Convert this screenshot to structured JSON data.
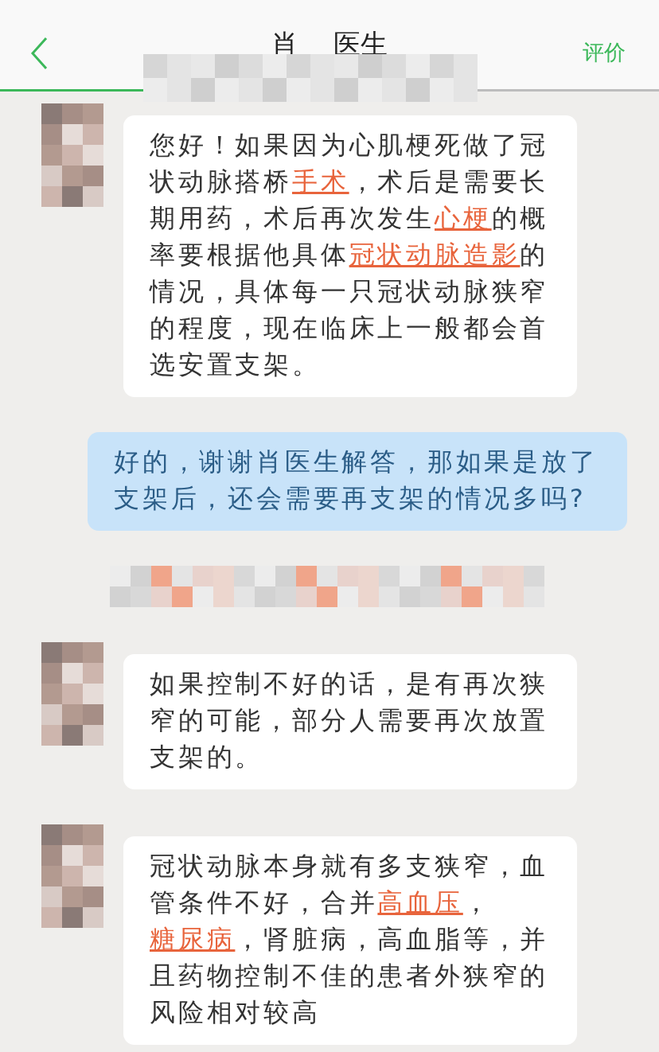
{
  "header": {
    "title_parts": [
      "肖",
      "医生"
    ],
    "action": "评价"
  },
  "messages": [
    {
      "kind": "received",
      "segments": [
        {
          "text": "您好！如果因为心肌梗死做了冠状动脉搭桥",
          "link": false
        },
        {
          "text": "手术",
          "link": true
        },
        {
          "text": "，术后是需要长期用药，术后再次发生",
          "link": false
        },
        {
          "text": "心梗",
          "link": true
        },
        {
          "text": "的概率要根据他具体",
          "link": false
        },
        {
          "text": "冠状动脉造影",
          "link": true
        },
        {
          "text": "的情况，具体每一只冠状动脉狭窄的程度，现在临床上一般都会首选安置支架。",
          "link": false
        }
      ]
    },
    {
      "kind": "sent",
      "segments": [
        {
          "text": "好的，谢谢肖医生解答，那如果是放了支架后，还会需要再支架的情况多吗?",
          "link": false
        }
      ]
    },
    {
      "kind": "redacted"
    },
    {
      "kind": "received",
      "segments": [
        {
          "text": "如果控制不好的话，是有再次狭窄的可能，部分人需要再次放置支架的。",
          "link": false
        }
      ]
    },
    {
      "kind": "received",
      "segments": [
        {
          "text": "冠状动脉本身就有多支狭窄，血管条件不好，合并",
          "link": false
        },
        {
          "text": "高血压",
          "link": true
        },
        {
          "text": "，",
          "link": false
        },
        {
          "text": "糖尿病",
          "link": true
        },
        {
          "text": "，肾脏病，高血脂等，并且药物控制不佳的患者外狭窄的风险相对较高",
          "link": false
        }
      ]
    }
  ]
}
